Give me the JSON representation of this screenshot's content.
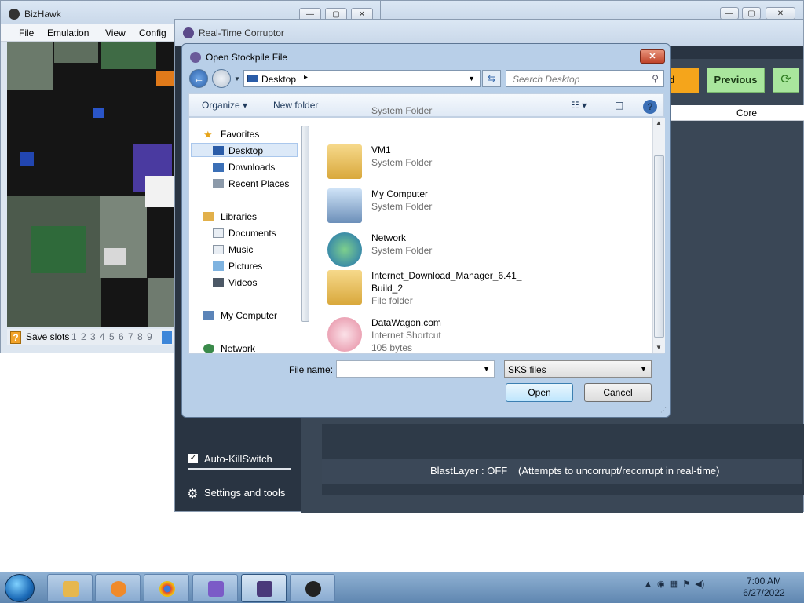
{
  "bizhawk": {
    "title": "BizHawk",
    "menu": [
      "File",
      "Emulation",
      "View",
      "Config"
    ],
    "status": {
      "label": "Save slots",
      "slots": "1 2 3 4 5 6 7 8 9"
    }
  },
  "rtc": {
    "title": "Real-Time Corruptor",
    "load_button": "d",
    "previous_button": "Previous",
    "refresh_glyph": "⟳",
    "grid_header": "Core",
    "autokill_label": "Auto-KillSwitch",
    "settings_label": "Settings and tools",
    "blast_status": "BlastLayer : OFF",
    "blast_desc": "(Attempts to uncorrupt/recorrupt in real-time)"
  },
  "dialog": {
    "title": "Open Stockpile File",
    "address": "Desktop",
    "search_placeholder": "Search Desktop",
    "organize": "Organize",
    "new_folder": "New folder",
    "nav": {
      "favorites": "Favorites",
      "desktop": "Desktop",
      "downloads": "Downloads",
      "recent": "Recent Places",
      "libraries": "Libraries",
      "documents": "Documents",
      "music": "Music",
      "pictures": "Pictures",
      "videos": "Videos",
      "my_computer": "My Computer",
      "network": "Network"
    },
    "files": [
      {
        "name": "",
        "type": "System Folder"
      },
      {
        "name": "VM1",
        "type": "System Folder"
      },
      {
        "name": "My Computer",
        "type": "System Folder"
      },
      {
        "name": "Network",
        "type": "System Folder"
      },
      {
        "name": "Internet_Download_Manager_6.41_",
        "name2": "Build_2",
        "type": "File folder"
      },
      {
        "name": "DataWagon.com",
        "type": "Internet Shortcut",
        "size": "105 bytes"
      }
    ],
    "filename_label": "File name:",
    "filename_value": "",
    "filetype": "SKS files",
    "open_button": "Open",
    "cancel_button": "Cancel"
  },
  "taskbar": {
    "time": "7:00 AM",
    "date": "6/27/2022"
  },
  "colors": {
    "rtc_bg": "#293442",
    "orange": "#f5a51b",
    "green": "#a9e69d",
    "selection": "#dce9f8"
  }
}
